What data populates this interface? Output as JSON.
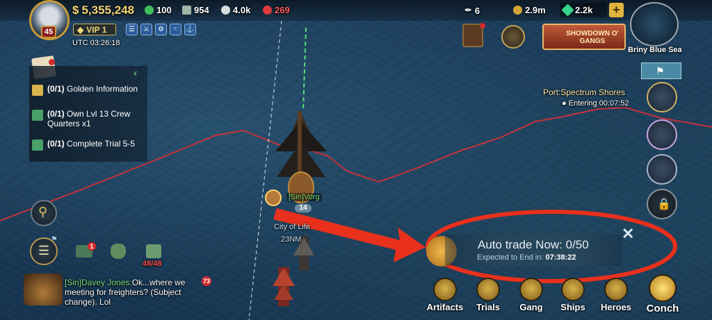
{
  "player": {
    "level": "45",
    "vip": "VIP 1",
    "clock": "UTC 03:26:18"
  },
  "resources": {
    "gold": "5,355,248",
    "green": "100",
    "crew": "954",
    "skull_white": "4.0k",
    "skull_red": "269",
    "feather": "6",
    "coin": "2.9m",
    "gem": "2.2k",
    "add": "+"
  },
  "event": {
    "banner": "SHOWDOWN O' GANGS"
  },
  "minimap": {
    "region": "Briny Blue Sea"
  },
  "port": {
    "name": "Port:Spectrum Shores",
    "status": "Entering 00:07:52"
  },
  "quests": [
    {
      "progress": "(0/1)",
      "text": "Golden Information"
    },
    {
      "progress": "(0/1)",
      "text": "Own Lvl 13 Crew Quarters x1"
    },
    {
      "progress": "(0/1)",
      "text": "Complete Trial 5-5"
    }
  ],
  "map": {
    "player_tag": "[Sin]Vorg",
    "player_level": "14",
    "city_name": "City of Life",
    "distance": "23NM"
  },
  "badges": {
    "mail": "1",
    "chat": "73"
  },
  "cargo": "48/48",
  "chat": {
    "speaker": "[Sin]Davey Jones:",
    "message": "Ok...where we meeting for freighters? (Subject change). Lol"
  },
  "trade": {
    "title": "Auto trade Now: 0/50",
    "sub_label": "Expected to End in:",
    "sub_time": "07:38:22"
  },
  "nav": [
    {
      "label": "Artifacts"
    },
    {
      "label": "Trials"
    },
    {
      "label": "Gang"
    },
    {
      "label": "Ships"
    },
    {
      "label": "Heroes"
    },
    {
      "label": "Conch"
    }
  ],
  "colors": {
    "annotation_red": "#e8301c",
    "route_red": "#c8323a",
    "gold": "#f5d777"
  }
}
